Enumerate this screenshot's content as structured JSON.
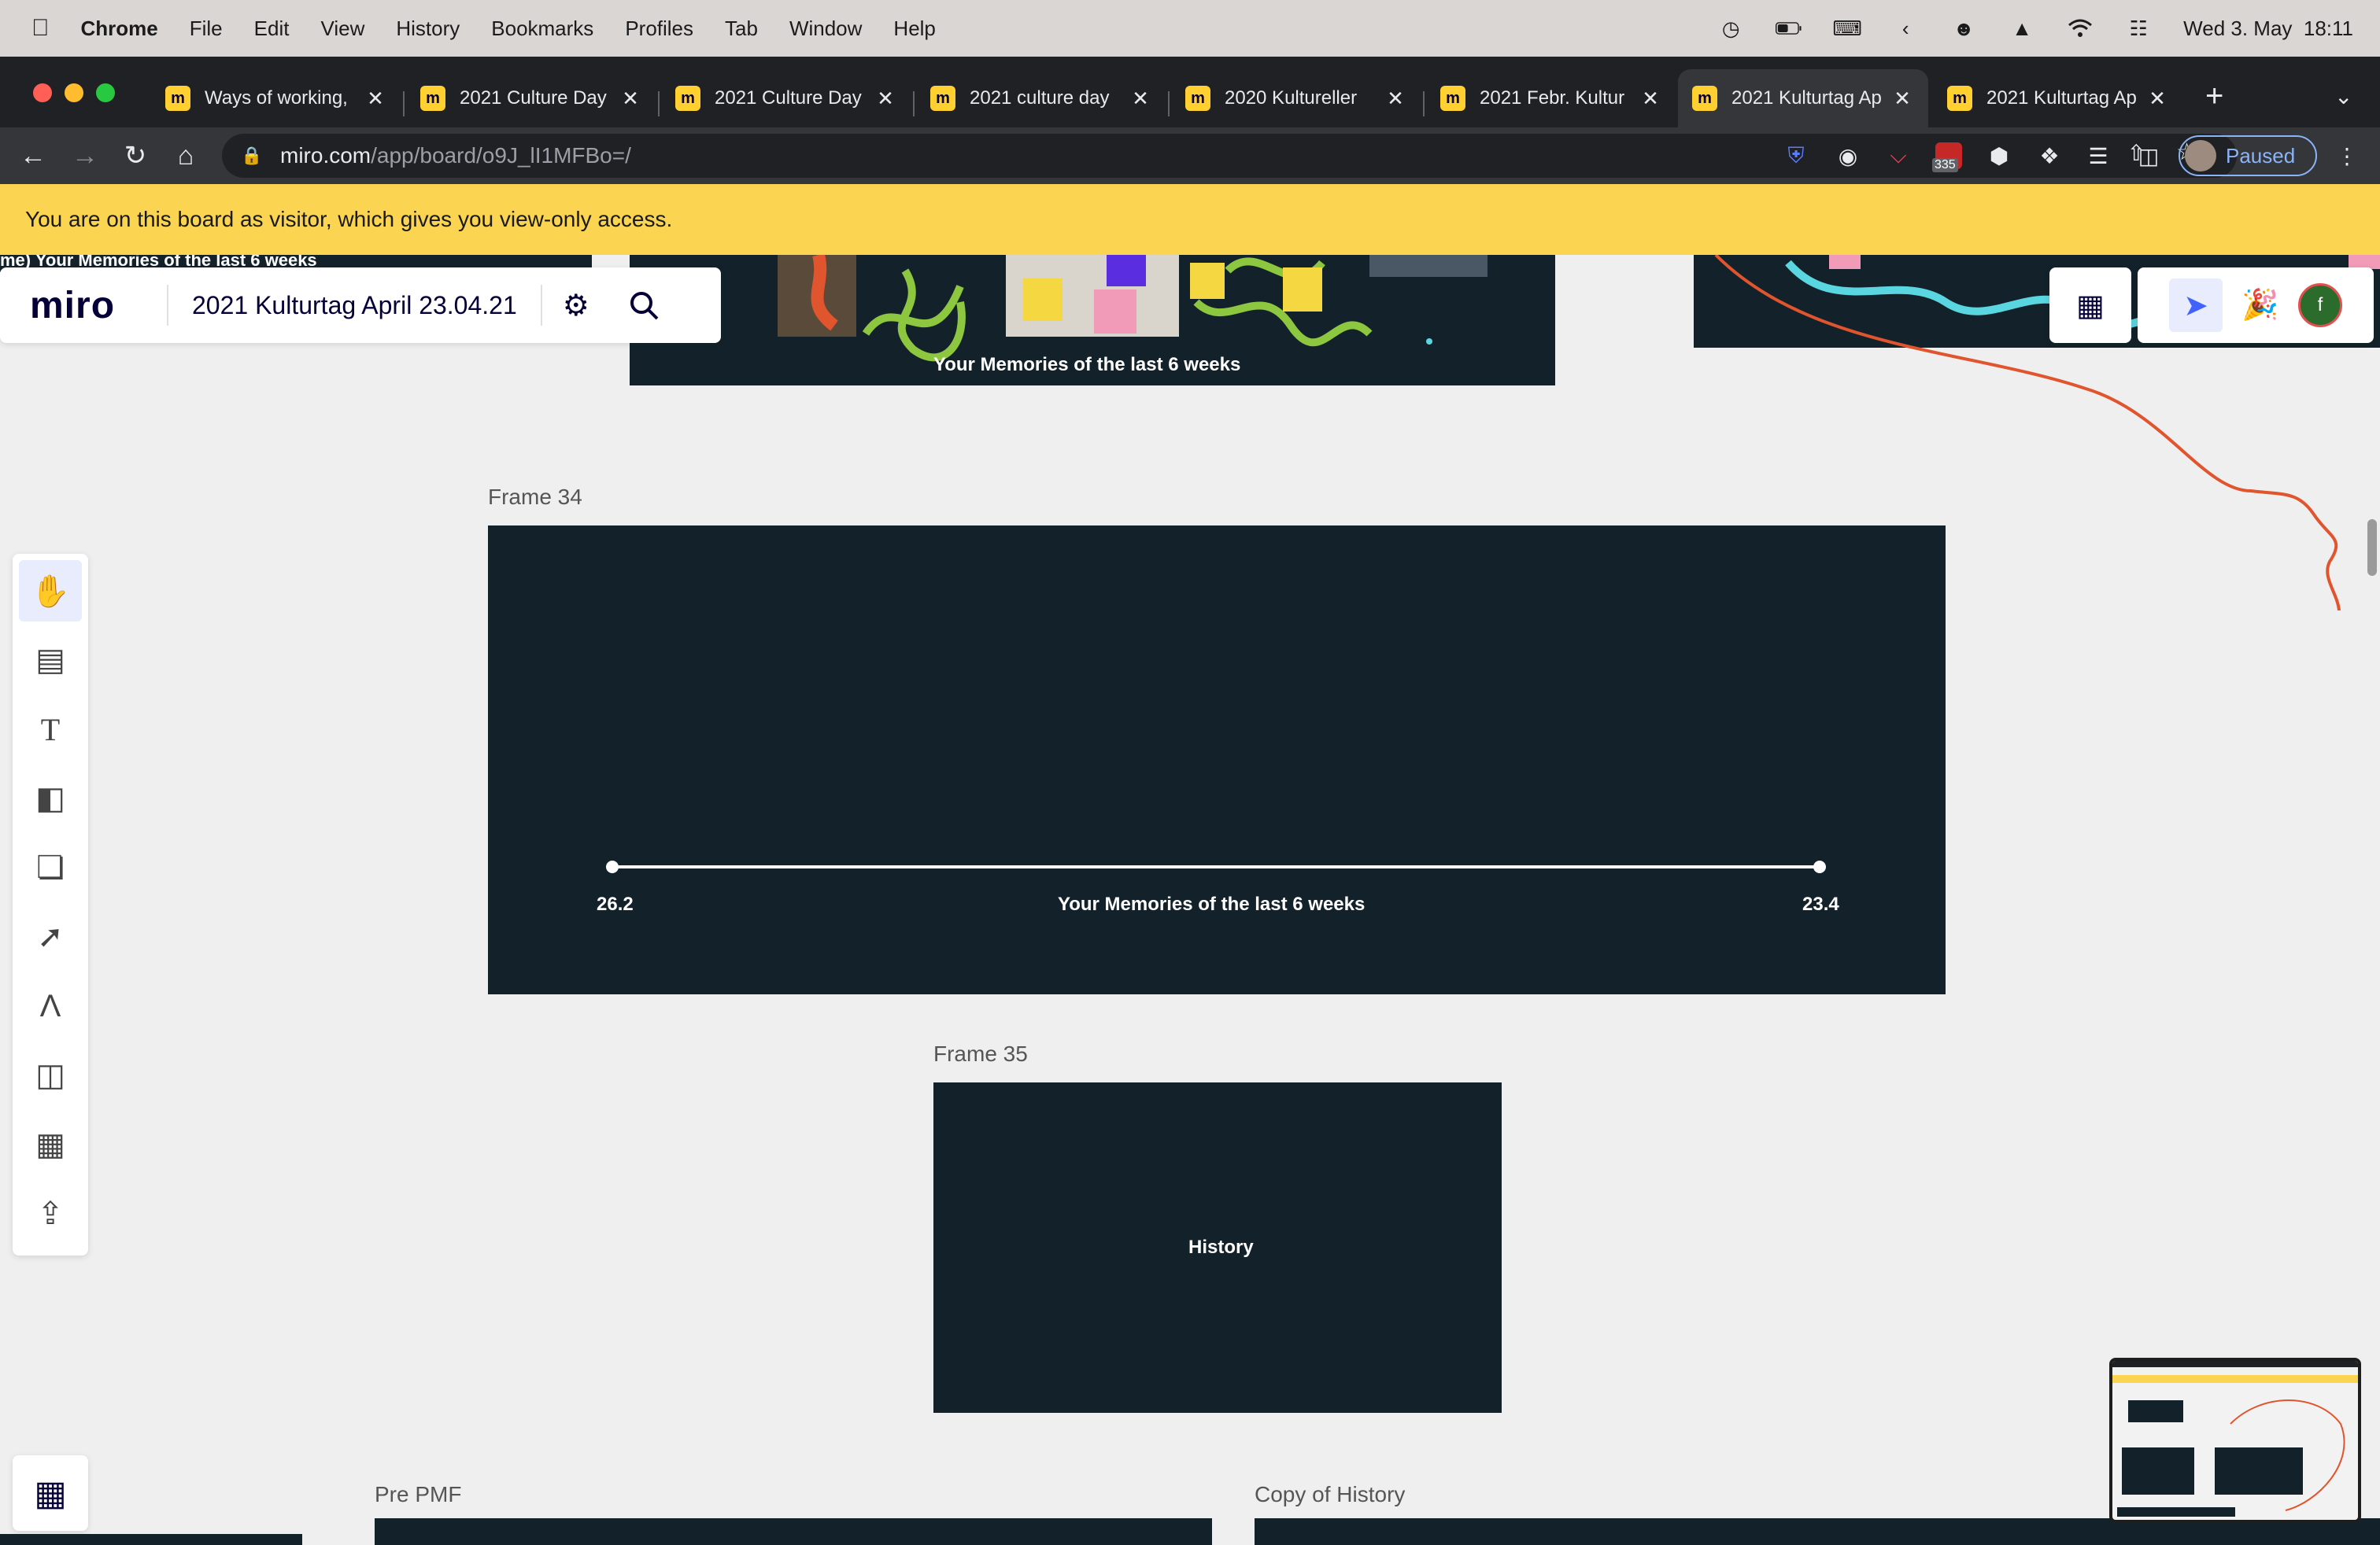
{
  "menubar": {
    "app": "Chrome",
    "items": [
      "File",
      "Edit",
      "View",
      "History",
      "Bookmarks",
      "Profiles",
      "Tab",
      "Window",
      "Help"
    ],
    "datetime": "Wed 3. May  18:11"
  },
  "tabs": [
    {
      "title": "Ways of working,",
      "active": false
    },
    {
      "title": "2021 Culture Day",
      "active": false
    },
    {
      "title": "2021 Culture Day",
      "active": false
    },
    {
      "title": "2021 culture day",
      "active": false
    },
    {
      "title": "2020 Kultureller",
      "active": false
    },
    {
      "title": "2021 Febr. Kultur",
      "active": false
    },
    {
      "title": "2021 Kulturtag Ap",
      "active": true
    },
    {
      "title": "2021 Kulturtag Ap",
      "active": false
    }
  ],
  "address": {
    "host": "miro.com",
    "path": "/app/board/o9J_lI1MFBo=/"
  },
  "extensions": {
    "badge": "335"
  },
  "profile": {
    "label": "Paused"
  },
  "banner": {
    "text": "You are on this board as visitor, which gives you view-only access."
  },
  "miro": {
    "logo": "miro",
    "board_title": "2021 Kulturtag April 23.04.21",
    "avatar_initial": "f"
  },
  "canvas": {
    "top_frame_caption": "Your Memories of the last 6 weeks",
    "frame34": {
      "title": "Frame 34",
      "start_label": "26.2",
      "end_label": "23.4",
      "center_label": "Your Memories of the last 6 weeks"
    },
    "frame35": {
      "title": "Frame 35",
      "label": "History"
    },
    "pre_pmf": {
      "title": "Pre PMF"
    },
    "copy_history": {
      "title": "Copy of History"
    }
  },
  "colors": {
    "frame_bg": "#13222a",
    "banner": "#fbd451",
    "miro_accent": "#4262ff",
    "path_line": "#e0542e"
  }
}
